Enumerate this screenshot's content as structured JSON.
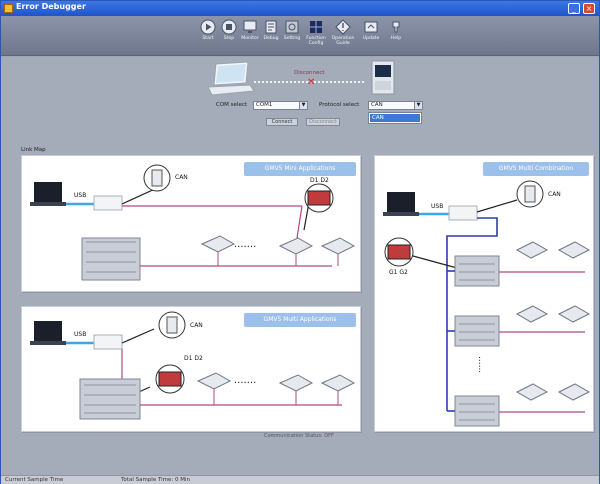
{
  "app": {
    "title": "Error Debugger"
  },
  "window_controls": {
    "minimize": "_",
    "close": "×"
  },
  "toolbar": {
    "items": [
      {
        "label": "Start",
        "icon": "play-icon"
      },
      {
        "label": "Stop",
        "icon": "stop-icon"
      },
      {
        "label": "Monitor",
        "icon": "monitor-icon"
      },
      {
        "label": "Debug",
        "icon": "debug-icon"
      },
      {
        "label": "Setting",
        "icon": "gear-icon"
      },
      {
        "label": "Function Config",
        "icon": "grid-icon"
      },
      {
        "label": "Operation Guide",
        "icon": "guide-icon"
      },
      {
        "label": "Update",
        "icon": "update-icon"
      },
      {
        "label": "Help",
        "icon": "help-icon"
      }
    ]
  },
  "connection": {
    "status": "Disconnect"
  },
  "selectors": {
    "com_label": "COM select",
    "com_value": "COM1",
    "protocol_label": "Protocol select",
    "protocol_value": "CAN",
    "protocol_options_visible": [
      "CAN"
    ],
    "connect_button": "Connect",
    "disconnect_button": "Disconnect"
  },
  "link_map": {
    "label": "Link Map"
  },
  "cards": {
    "top_left": {
      "title": "GMV5 Mini Applications",
      "usb": "USB",
      "can": "CAN",
      "port": "D1 D2"
    },
    "bottom_left": {
      "title": "GMV5 Multi Applications",
      "usb": "USB",
      "can": "CAN",
      "port": "D1 D2"
    },
    "right": {
      "title": "GMV5 Multi Combination",
      "usb": "USB",
      "can": "CAN",
      "port": "G1 G2"
    }
  },
  "footer_note": "Communication Status: OFF",
  "status": {
    "left": "Current Sample Time",
    "right": "Total Sample Time: 0 Min"
  },
  "colors": {
    "titlebar": "#1f54c8",
    "wire_pink": "#b04a84",
    "wire_blue": "#2f3ea8",
    "usb_blue": "#39a8e6"
  }
}
